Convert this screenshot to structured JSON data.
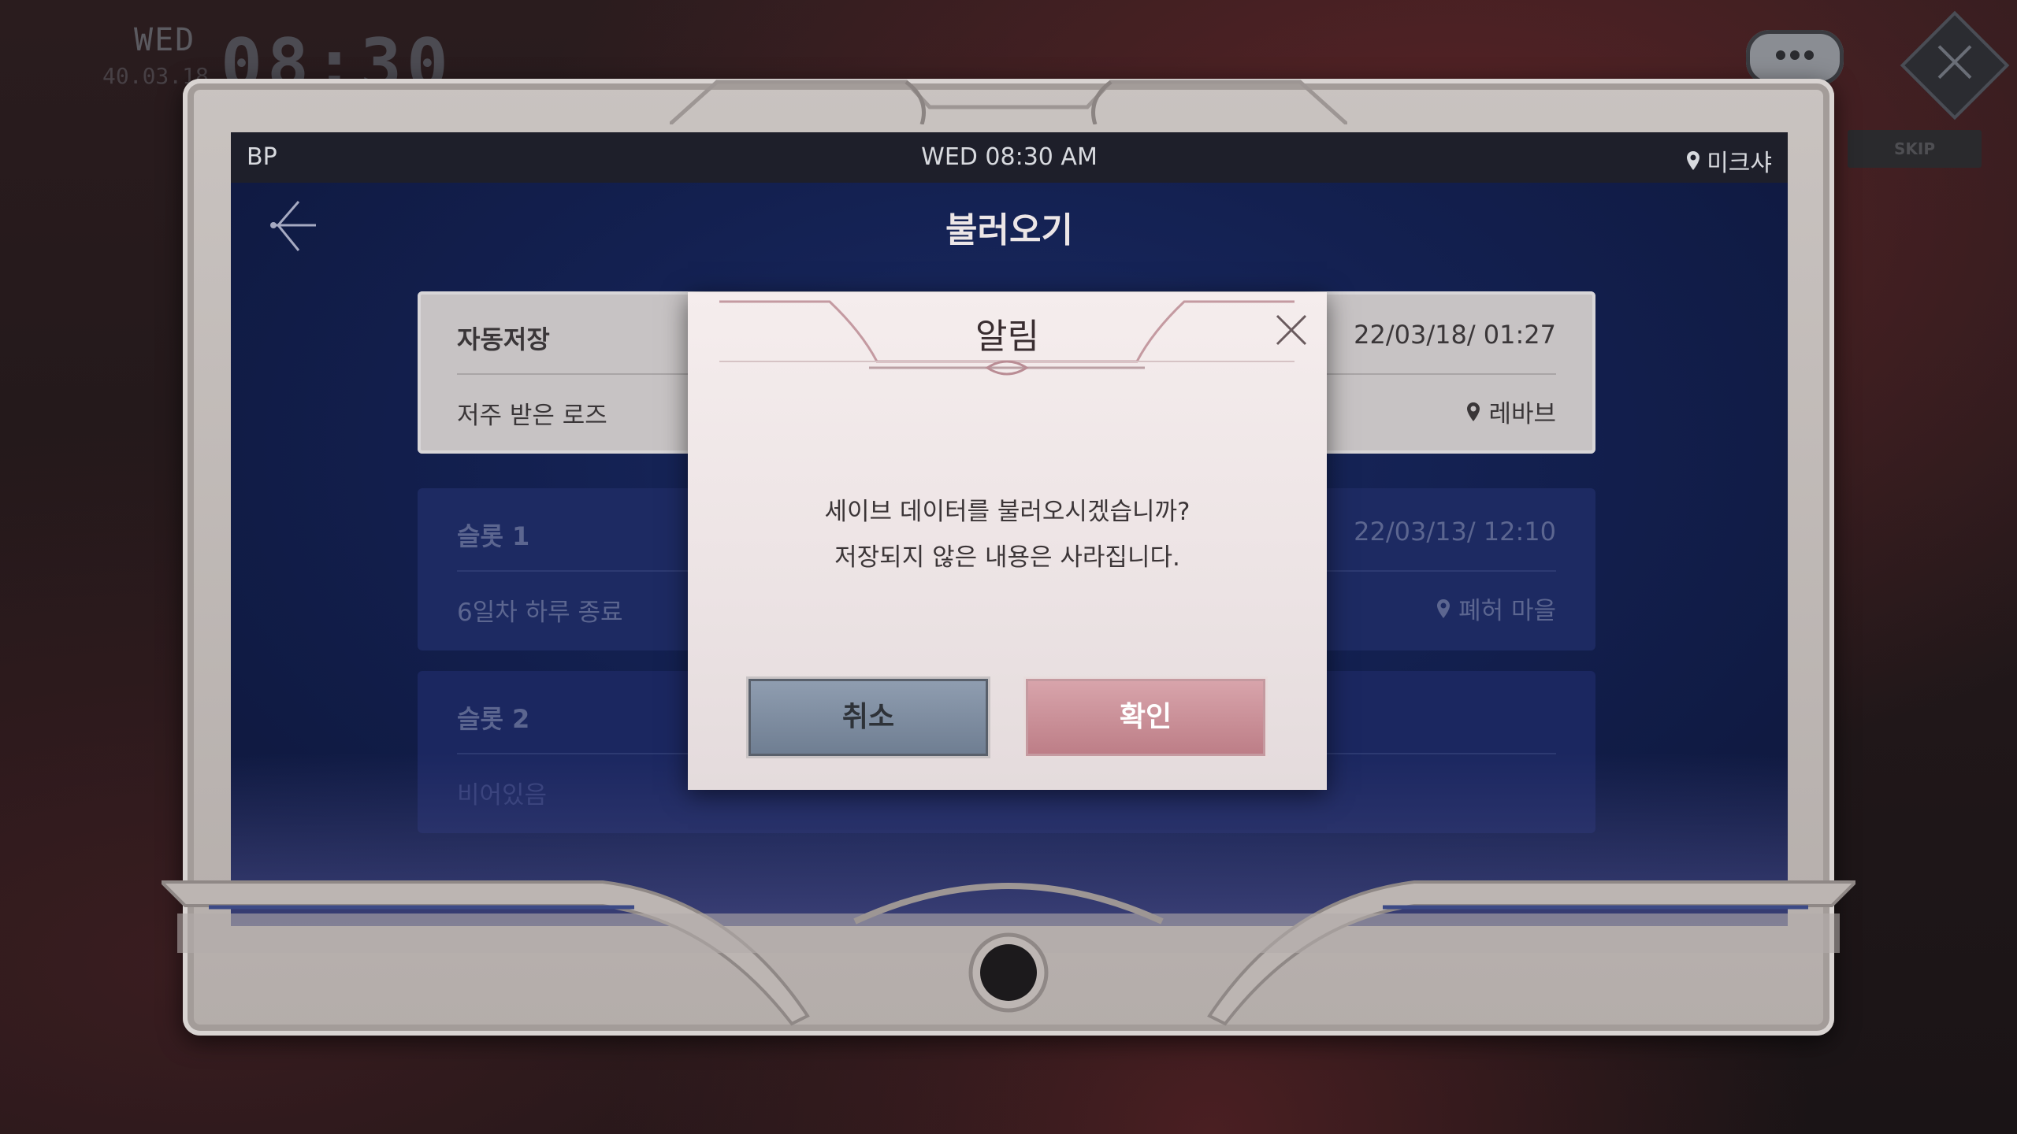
{
  "hud": {
    "day": "WED",
    "date": "40.03.18",
    "time": "08:30",
    "skip_label": "SKIP",
    "chat_icon": "chat-bubble-icon",
    "close_icon": "close-icon"
  },
  "status_bar": {
    "left": "BP",
    "center": "WED 08:30 AM",
    "location": "미크샤"
  },
  "screen": {
    "title": "불러오기",
    "back_icon": "back-arrow-icon"
  },
  "slots": [
    {
      "name": "자동저장",
      "description": "저주 받은 로즈",
      "date": "22/03/18/ 01:27",
      "location": "레바브"
    },
    {
      "name": "슬롯 1",
      "description": "6일차 하루 종료",
      "date": "22/03/13/ 12:10",
      "location": "폐허 마을"
    },
    {
      "name": "슬롯 2",
      "description": "비어있음"
    }
  ],
  "modal": {
    "title": "알림",
    "message_line1": "세이브 데이터를 불러오시겠습니까?",
    "message_line2": "저장되지 않은 내용은 사라집니다.",
    "cancel_label": "취소",
    "confirm_label": "확인"
  },
  "colors": {
    "screen_bg": "#132050",
    "frame": "#c9c3c0",
    "cancel_button": "#7c8aa0",
    "confirm_button": "#c98e96",
    "fox_button": "#4a8aba"
  }
}
